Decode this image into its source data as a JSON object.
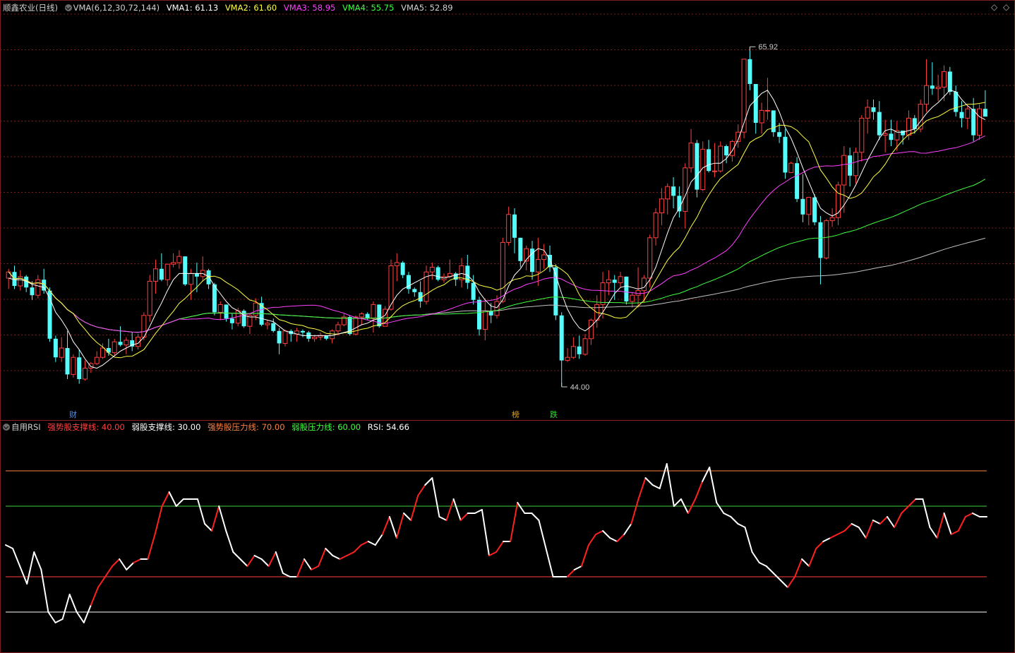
{
  "header": {
    "stock": "顺鑫农业",
    "period": "(日线)",
    "indicator": "VMA(6,12,30,72,144)",
    "vma1": "VMA1: 61.13",
    "vma2": "VMA2: 61.60",
    "vma3": "VMA3: 58.95",
    "vma4": "VMA4: 55.75",
    "vma5": "VMA5: 52.89"
  },
  "window_buttons": {
    "restore": "◇",
    "close": "◇"
  },
  "annotations": {
    "high": "65.92",
    "low": "44.00"
  },
  "event_tags": [
    {
      "text": "财",
      "color": "#5b8fd8"
    },
    {
      "text": "榜",
      "color": "#e0a020"
    },
    {
      "text": "跌",
      "color": "#40d040"
    }
  ],
  "rsi_header": {
    "name": "自用RSI",
    "strong_support": "强势股支撑线: 40.00",
    "weak_support": "弱股支撑线: 30.00",
    "strong_pressure": "强势股压力线: 70.00",
    "weak_pressure": "弱股压力线: 60.00",
    "rsi": "RSI: 54.66"
  },
  "colors": {
    "up": "#ff4040",
    "down": "#54fcfc",
    "vma1": "#ffffff",
    "vma2": "#ffff40",
    "vma3": "#ff40ff",
    "vma4": "#40ff40",
    "vma5": "#c0c0c0",
    "grid": "#7a1e1e"
  },
  "chart_data": [
    {
      "type": "candlestick",
      "title": "顺鑫农业 (日线)",
      "ylim": [
        43,
        68
      ],
      "bars": [
        [
          51,
          51.6,
          50.3,
          51.4
        ],
        [
          51.4,
          51.8,
          50.3,
          50.5
        ],
        [
          50.5,
          51.5,
          50.2,
          51.1
        ],
        [
          51.1,
          51.2,
          50.1,
          50.4
        ],
        [
          50.4,
          50.8,
          49.6,
          49.9
        ],
        [
          49.9,
          51.2,
          49.7,
          50.9
        ],
        [
          50.9,
          51.6,
          50,
          50.2
        ],
        [
          50.2,
          50.4,
          46.9,
          47.1
        ],
        [
          47.1,
          47.3,
          45.6,
          45.9
        ],
        [
          45.9,
          47.2,
          45.6,
          46.5
        ],
        [
          46.5,
          47.6,
          44.5,
          44.8
        ],
        [
          44.8,
          46.1,
          44.6,
          45.9
        ],
        [
          45.9,
          46.4,
          44.2,
          44.5
        ],
        [
          44.5,
          45.7,
          44.4,
          45.2
        ],
        [
          45.2,
          45.6,
          44.9,
          45.5
        ],
        [
          45.5,
          46.3,
          45.4,
          45.9
        ],
        [
          45.9,
          46.8,
          45.8,
          46.5
        ],
        [
          46.5,
          47.1,
          46,
          46.2
        ],
        [
          46.2,
          47.1,
          46,
          46.9
        ],
        [
          46.9,
          47.9,
          46.6,
          46.7
        ],
        [
          46.7,
          47.2,
          46.1,
          47
        ],
        [
          47,
          47.5,
          46.3,
          46.6
        ],
        [
          46.6,
          47.4,
          46.4,
          47.2
        ],
        [
          47.2,
          48.8,
          47,
          48.6
        ],
        [
          48.6,
          51.2,
          48.2,
          50.8
        ],
        [
          50.8,
          52.2,
          50,
          51.6
        ],
        [
          51.6,
          52.6,
          50.8,
          50.9
        ],
        [
          50.9,
          51.9,
          50.5,
          51.9
        ],
        [
          51.9,
          52.6,
          51.7,
          52
        ],
        [
          52,
          52.8,
          51.6,
          52.4
        ],
        [
          52.4,
          52.4,
          50.5,
          50.6
        ],
        [
          50.6,
          51.6,
          49.6,
          51.3
        ],
        [
          51.3,
          52,
          50.1,
          51.1
        ],
        [
          51.1,
          52.4,
          50.8,
          51.5
        ],
        [
          51.5,
          51.6,
          50.3,
          50.6
        ],
        [
          50.6,
          50.7,
          48.6,
          48.8
        ],
        [
          48.8,
          49.5,
          48.3,
          49.3
        ],
        [
          49.3,
          49.3,
          48.2,
          48.4
        ],
        [
          48.4,
          48.7,
          47.7,
          48.1
        ],
        [
          48.1,
          49.1,
          47.9,
          48.9
        ],
        [
          48.9,
          49,
          47.8,
          47.9
        ],
        [
          47.9,
          48.7,
          47.4,
          48.6
        ],
        [
          48.6,
          49.7,
          48.3,
          49.4
        ],
        [
          49.4,
          49.8,
          47.9,
          48
        ],
        [
          48,
          48.3,
          47.7,
          48.1
        ],
        [
          48.1,
          48.4,
          47.5,
          47.6
        ],
        [
          47.6,
          47.8,
          46.1,
          46.8
        ],
        [
          46.8,
          47.7,
          46.6,
          47.6
        ],
        [
          47.6,
          47.7,
          46.9,
          47.4
        ],
        [
          47.4,
          47.8,
          46.9,
          47.6
        ],
        [
          47.6,
          47.7,
          47.2,
          47.5
        ],
        [
          47.5,
          47.6,
          46.9,
          47.1
        ],
        [
          47.1,
          47.3,
          46.9,
          47.2
        ],
        [
          47.2,
          47.5,
          47,
          47.3
        ],
        [
          47.3,
          47.3,
          47,
          47.1
        ],
        [
          47.1,
          47.7,
          46.8,
          47.6
        ],
        [
          47.6,
          48.2,
          47.3,
          48
        ],
        [
          48,
          48.7,
          47.9,
          48.5
        ],
        [
          48.5,
          48.6,
          47.3,
          47.4
        ],
        [
          47.4,
          48.6,
          47.3,
          48.5
        ],
        [
          48.5,
          48.8,
          48,
          48.7
        ],
        [
          48.7,
          48.8,
          48.3,
          48.4
        ],
        [
          48.4,
          49.5,
          47.5,
          49.3
        ],
        [
          49.3,
          49.3,
          47.8,
          47.9
        ],
        [
          47.9,
          49.2,
          47.9,
          49
        ],
        [
          49,
          52.2,
          48.9,
          51.8
        ],
        [
          51.8,
          52.6,
          50.8,
          52
        ],
        [
          52,
          52.1,
          51,
          51.2
        ],
        [
          51.2,
          51.4,
          50,
          50.3
        ],
        [
          50.3,
          50.4,
          49.8,
          50.1
        ],
        [
          50.1,
          50.8,
          49.1,
          49.5
        ],
        [
          49.5,
          51.8,
          49.3,
          51.4
        ],
        [
          51.4,
          52,
          50.9,
          51.7
        ],
        [
          51.7,
          51.8,
          50.8,
          50.9
        ],
        [
          50.9,
          51.3,
          50.7,
          51.1
        ],
        [
          51.1,
          52.2,
          51,
          51.3
        ],
        [
          51.3,
          51.4,
          50.5,
          50.9
        ],
        [
          50.9,
          52.3,
          50.4,
          51.8
        ],
        [
          51.8,
          52.5,
          50.3,
          50.7
        ],
        [
          50.7,
          51.2,
          49.3,
          49.6
        ],
        [
          49.6,
          49.8,
          47.3,
          47.7
        ],
        [
          47.7,
          49.7,
          47,
          48.9
        ],
        [
          48.9,
          49.4,
          48.1,
          48.6
        ],
        [
          48.6,
          49.9,
          48.4,
          49.5
        ],
        [
          49.5,
          53.6,
          49.4,
          53.3
        ],
        [
          53.3,
          55.6,
          53.1,
          55.1
        ],
        [
          55.1,
          55.5,
          52.6,
          53.6
        ],
        [
          53.6,
          53.6,
          51.7,
          52.1
        ],
        [
          52.1,
          53.1,
          51.5,
          52.9
        ],
        [
          52.9,
          53.4,
          50.9,
          51.4
        ],
        [
          51.4,
          53.6,
          50.5,
          52.2
        ],
        [
          52.2,
          53.2,
          51.6,
          52.5
        ],
        [
          52.5,
          53.1,
          51.4,
          51.7
        ],
        [
          51.7,
          51.9,
          48.3,
          48.6
        ],
        [
          48.6,
          48.8,
          44,
          45.7
        ],
        [
          45.7,
          46.5,
          45.6,
          45.9
        ],
        [
          45.9,
          47.2,
          45.8,
          46.6
        ],
        [
          46.6,
          47.3,
          45.8,
          46.1
        ],
        [
          46.1,
          47.4,
          46,
          47.1
        ],
        [
          47.1,
          48.4,
          46.7,
          48.3
        ],
        [
          48.3,
          49.9,
          47.8,
          49.3
        ],
        [
          49.3,
          51.4,
          48.4,
          50.7
        ],
        [
          50.7,
          51.5,
          49.9,
          50.9
        ],
        [
          50.9,
          51.2,
          49.6,
          50.7
        ],
        [
          50.7,
          51.4,
          50.4,
          51.1
        ],
        [
          51.1,
          51.1,
          49.3,
          49.5
        ],
        [
          49.5,
          50.1,
          49.1,
          49.9
        ],
        [
          49.9,
          51.7,
          49.1,
          50.2
        ],
        [
          50.2,
          51.2,
          49.4,
          51
        ],
        [
          51,
          53.8,
          50.4,
          53.6
        ],
        [
          53.6,
          55.5,
          53.1,
          55.2
        ],
        [
          55.2,
          56.8,
          54.4,
          56.1
        ],
        [
          56.1,
          57.1,
          55.1,
          56.9
        ],
        [
          56.9,
          57.5,
          55.5,
          56.3
        ],
        [
          56.3,
          56.9,
          54.9,
          55.3
        ],
        [
          55.3,
          58.4,
          54.2,
          58.1
        ],
        [
          58.1,
          60.6,
          57.8,
          59.7
        ],
        [
          59.7,
          59.9,
          56.2,
          56.7
        ],
        [
          56.7,
          59.8,
          56.6,
          59.3
        ],
        [
          59.3,
          59.9,
          57.8,
          57.9
        ],
        [
          57.9,
          59.7,
          57.5,
          57.9
        ],
        [
          57.9,
          59.8,
          57.8,
          59.5
        ],
        [
          59.5,
          59.6,
          58.4,
          58.9
        ],
        [
          58.9,
          59.9,
          58.5,
          59.8
        ],
        [
          59.8,
          60.9,
          59.4,
          60.4
        ],
        [
          60.4,
          65.1,
          60,
          65.1
        ],
        [
          65.1,
          65.9,
          63.1,
          63.5
        ],
        [
          63.5,
          63.5,
          60.3,
          61
        ],
        [
          61,
          62.3,
          60.3,
          61.8
        ],
        [
          61.8,
          63.9,
          61.2,
          61.8
        ],
        [
          61.8,
          61.8,
          60.1,
          60.4
        ],
        [
          60.4,
          61,
          59.7,
          60.1
        ],
        [
          60.1,
          60.6,
          57.4,
          57.8
        ],
        [
          57.8,
          58.5,
          57.8,
          58.4
        ],
        [
          58.4,
          58.8,
          55.9,
          56.1
        ],
        [
          56.1,
          57.7,
          54.6,
          55.1
        ],
        [
          55.1,
          56.1,
          54.4,
          56.2
        ],
        [
          56.2,
          56.4,
          54.4,
          54.6
        ],
        [
          54.6,
          55,
          50.6,
          52.3
        ],
        [
          52.3,
          54.8,
          52.2,
          54.7
        ],
        [
          54.7,
          55.5,
          54.3,
          54.9
        ],
        [
          54.9,
          57.2,
          54.4,
          57
        ],
        [
          57,
          59.5,
          55.2,
          58.9
        ],
        [
          58.9,
          59.4,
          56.9,
          57.6
        ],
        [
          57.6,
          59.4,
          57.1,
          59.1
        ],
        [
          59.1,
          61.5,
          58.5,
          61.3
        ],
        [
          61.3,
          62.5,
          60.3,
          62
        ],
        [
          62,
          62.5,
          61.2,
          61.7
        ],
        [
          61.7,
          62.4,
          59.9,
          60.2
        ],
        [
          60.2,
          61.2,
          59.1,
          60.3
        ],
        [
          60.3,
          61.2,
          59.5,
          59.9
        ],
        [
          59.9,
          61.1,
          59.2,
          60.5
        ],
        [
          60.5,
          60.5,
          59.6,
          60.2
        ],
        [
          60.2,
          61.8,
          59.9,
          61.3
        ],
        [
          61.3,
          61.5,
          60.3,
          60.6
        ],
        [
          60.6,
          62.5,
          60.4,
          62.2
        ],
        [
          62.2,
          65.1,
          61.7,
          63.4
        ],
        [
          63.4,
          64.9,
          62.8,
          63.2
        ],
        [
          63.2,
          64.1,
          62.4,
          63.3
        ],
        [
          63.3,
          64.7,
          62.4,
          64.3
        ],
        [
          64.3,
          64.6,
          62.8,
          63
        ],
        [
          63,
          63.4,
          61.4,
          61.7
        ],
        [
          61.7,
          62.4,
          60.7,
          61.3
        ],
        [
          61.3,
          62.1,
          60.6,
          61.9
        ],
        [
          61.9,
          62.6,
          59.8,
          60.2
        ],
        [
          60.2,
          62.2,
          59.9,
          61.9
        ],
        [
          61.9,
          63.1,
          61.5,
          61.4
        ]
      ],
      "vma1": [
        51,
        50.9,
        50.9,
        50.8,
        50.6,
        50.5,
        50.4,
        49.7,
        48.8,
        48.3,
        47.7,
        46.9,
        46.4,
        45.8,
        45.3,
        45.2,
        45.4,
        45.7,
        46,
        46.3,
        46.5,
        46.7,
        46.8,
        47.2,
        47.9,
        48.7,
        49.4,
        50.2,
        50.9,
        51.3,
        51.3,
        51.3,
        51.3,
        51.3,
        51.1,
        50.5,
        50,
        49.5,
        49.1,
        48.9,
        48.6,
        48.5,
        48.5,
        48.4,
        48.3,
        48.2,
        47.9,
        47.6,
        47.5,
        47.4,
        47.3,
        47.3,
        47.3,
        47.3,
        47.3,
        47.3,
        47.4,
        47.5,
        47.6,
        47.8,
        48,
        48.1,
        48.3,
        48.4,
        48.6,
        49.3,
        49.9,
        50.3,
        50.5,
        50.7,
        50.9,
        51.1,
        51.2,
        51.1,
        51,
        51.1,
        51.2,
        51.3,
        51.2,
        50.8,
        50.1,
        49.6,
        49.2,
        49.1,
        49.6,
        50.5,
        51.2,
        51.6,
        52.2,
        52.6,
        52.9,
        52.8,
        52.2,
        51.2,
        50,
        49,
        48.3,
        47.8,
        47.6,
        47.9,
        48.3,
        48.8,
        49.4,
        50,
        50.4,
        50.5,
        50.4,
        50.3,
        50.4,
        50.9,
        51.7,
        52.8,
        53.9,
        54.9,
        55.5,
        56.3,
        57.2,
        57.6,
        58.1,
        58.3,
        58.4,
        58.4,
        58.7,
        59.2,
        59.9,
        61,
        62.1,
        62.5,
        62.9,
        63.1,
        62.5,
        61.7,
        60.7,
        60,
        59.1,
        58.1,
        57.2,
        56.3,
        55.5,
        55.2,
        55,
        55.2,
        55.7,
        56.3,
        57,
        57.8,
        58.6,
        59.3,
        60,
        60.5,
        60.6,
        60.4,
        60.4,
        60.5,
        60.6,
        61.1,
        61.6,
        62,
        62.3,
        62.7,
        63.1,
        63,
        62.5,
        62.1,
        61.8,
        61.4,
        61.2
      ]
    },
    {
      "type": "line",
      "title": "自用RSI",
      "ylim": [
        20,
        80
      ],
      "hlines": [
        {
          "label": "强势股支撑线",
          "value": 40,
          "color": "#ff4040"
        },
        {
          "label": "弱股支撑线",
          "value": 30,
          "color": "#ffffff"
        },
        {
          "label": "强势股压力线",
          "value": 70,
          "color": "#ff8040"
        },
        {
          "label": "弱股压力线",
          "value": 60,
          "color": "#40d040"
        }
      ],
      "rsi": [
        49,
        48,
        43,
        38,
        47,
        42,
        30,
        27,
        28,
        35,
        30,
        27,
        32,
        37,
        40,
        43,
        45,
        42,
        44,
        45,
        45,
        52,
        60,
        64,
        60,
        62,
        62,
        62,
        55,
        53,
        60,
        53,
        47,
        45,
        43,
        46,
        45,
        43,
        47,
        41,
        40,
        40,
        45,
        42,
        43,
        48,
        46,
        45,
        46,
        47,
        49,
        50,
        49,
        52,
        57,
        51,
        58,
        56,
        63,
        66,
        68,
        57,
        56,
        62,
        56,
        58,
        58,
        59,
        46,
        47,
        50,
        50,
        61,
        58,
        58,
        56,
        48,
        40,
        40,
        40,
        42,
        43,
        49,
        52,
        53,
        51,
        50,
        52,
        55,
        62,
        68,
        66,
        65,
        72,
        60,
        62,
        58,
        62,
        67,
        71,
        61,
        58,
        57,
        55,
        54,
        47,
        44,
        43,
        41,
        39,
        37,
        40,
        45,
        43,
        48,
        50,
        51,
        52,
        53,
        55,
        54,
        51,
        56,
        55,
        57,
        54,
        58,
        60,
        62,
        62,
        54,
        51,
        58,
        52,
        53,
        57,
        58,
        57,
        57
      ]
    }
  ]
}
